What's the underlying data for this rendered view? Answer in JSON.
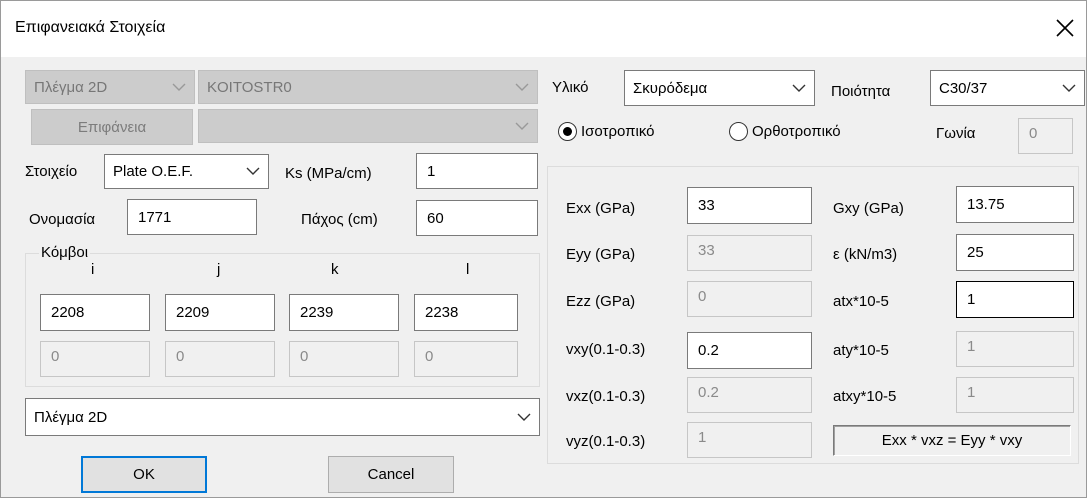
{
  "window": {
    "title": "Επιφανειακά Στοιχεία",
    "close_symbol": "✕"
  },
  "left": {
    "mesh_combo": "Πλέγμα 2D",
    "name_combo": "KOITOSTR0",
    "surface_button": "Επιφάνεια",
    "surface_combo": "",
    "element_label": "Στοιχείο",
    "element_combo": "Plate O.E.F.",
    "ks_label": "Ks (MPa/cm)",
    "ks_value": "1",
    "name_label": "Ονομασία",
    "name_value": "1771",
    "thickness_label": "Πάχος (cm)",
    "thickness_value": "60",
    "nodes_group": "Κόμβοι",
    "node_headers": [
      "i",
      "j",
      "k",
      "l"
    ],
    "node_values": [
      "2208",
      "2209",
      "2239",
      "2238"
    ],
    "node_values2": [
      "0",
      "0",
      "0",
      "0"
    ],
    "bottom_combo": "Πλέγμα 2D",
    "ok_button": "OK",
    "cancel_button": "Cancel"
  },
  "right": {
    "material_label": "Υλικό",
    "material_combo": "Σκυρόδεμα",
    "quality_label": "Ποιότητα",
    "quality_combo": "C30/37",
    "isotropic_label": "Ισοτροπικό",
    "isotropic_selected": true,
    "orthotropic_label": "Ορθοτροπικό",
    "angle_label": "Γωνία",
    "angle_value": "0",
    "exx_label": "Exx (GPa)",
    "exx_value": "33",
    "eyy_label": "Eyy (GPa)",
    "eyy_value": "33",
    "ezz_label": "Ezz (GPa)",
    "ezz_value": "0",
    "vxy_label": "vxy(0.1-0.3)",
    "vxy_value": "0.2",
    "vxz_label": "vxz(0.1-0.3)",
    "vxz_value": "0.2",
    "vyz_label": "vyz(0.1-0.3)",
    "vyz_value": "1",
    "gxy_label": "Gxy (GPa)",
    "gxy_value": "13.75",
    "eps_label": "ε (kN/m3)",
    "eps_value": "25",
    "atx_label": "atx*10-5",
    "atx_value": "1",
    "aty_label": "aty*10-5",
    "aty_value": "1",
    "atxy_label": "atxy*10-5",
    "atxy_value": "1",
    "formula": "Exx * vxz = Eyy * vxy"
  }
}
